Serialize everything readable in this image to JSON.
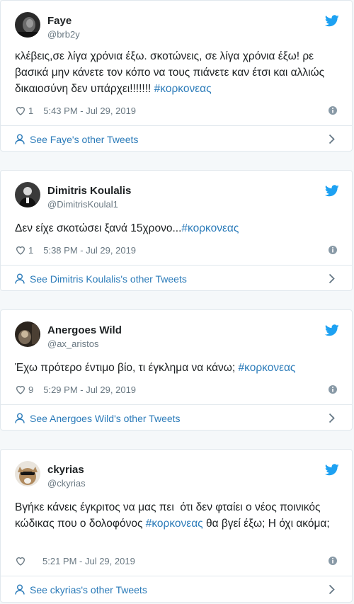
{
  "colors": {
    "link": "#2b7bb9",
    "muted": "#697882",
    "bird": "#1da1f2",
    "border": "#e1e8ed"
  },
  "icons": {
    "like": "heart-icon",
    "info": "info-icon",
    "brand": "twitter-bird-icon",
    "profile": "person-icon",
    "more": "chevron-right-icon"
  },
  "tweets": [
    {
      "name": "Faye",
      "handle": "@brb2y",
      "text_parts": [
        "κλέβεις,σε λίγα χρόνια έξω. σκοτώνεις, σε λίγα χρόνια έξω! ρε βασικά μην κάνετε τον κόπο να τους πιάνετε καν έτσι και αλλιώς δικαιοσύνη δεν υπάρχει!!!!!!! ",
        "#κορκονεας"
      ],
      "likes": "1",
      "timestamp": "5:43 PM - Jul 29, 2019",
      "footer": "See Faye's other Tweets"
    },
    {
      "name": "Dimitris Koulalis",
      "handle": "@DimitrisKoulal1",
      "text_parts": [
        "Δεν είχε σκοτώσει ξανά 15χρονο...",
        "#κορκονεας"
      ],
      "likes": "1",
      "timestamp": "5:38 PM - Jul 29, 2019",
      "footer": "See Dimitris Koulalis's other Tweets"
    },
    {
      "name": "Anergoes Wild",
      "handle": "@ax_aristos",
      "text_parts": [
        "Έχω πρότερο έντιμο βίο, τι έγκλημα να κάνω; ",
        "#κορκονεας"
      ],
      "likes": "9",
      "timestamp": "5:29 PM - Jul 29, 2019",
      "footer": "See Anergoes Wild's other Tweets"
    },
    {
      "name": "ckyrias",
      "handle": "@ckyrias",
      "text_parts": [
        "Βγήκε κάνεις έγκριτος να μας πει  ότι δεν φταίει ο νέος ποινικός κώδικας που ο δολοφόνος ",
        "#κορκονεας",
        " θα βγεί έξω; Η όχι ακόμα;"
      ],
      "likes": "",
      "timestamp": "5:21 PM - Jul 29, 2019",
      "footer": "See ckyrias's other Tweets"
    }
  ]
}
